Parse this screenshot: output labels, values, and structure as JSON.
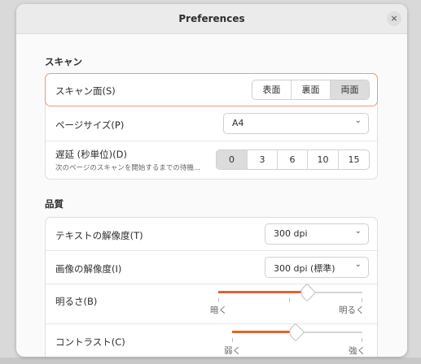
{
  "window": {
    "title": "Preferences",
    "close_glyph": "×"
  },
  "scan_section": {
    "title": "スキャン",
    "scan_side": {
      "label": "スキャン面(S)",
      "options": [
        "表面",
        "裏面",
        "両面"
      ],
      "selected": "両面"
    },
    "page_size": {
      "label": "ページサイズ(P)",
      "value": "A4"
    },
    "delay": {
      "label": "遅延 (秒単位)(D)",
      "sublabel": "次のページのスキャンを開始するまでの待機...",
      "options": [
        "0",
        "3",
        "6",
        "10",
        "15"
      ],
      "selected": "0"
    }
  },
  "quality_section": {
    "title": "品質",
    "text_resolution": {
      "label": "テキストの解像度(T)",
      "value": "300 dpi"
    },
    "image_resolution": {
      "label": "画像の解像度(I)",
      "value": "300 dpi (標準)"
    },
    "brightness": {
      "label": "明るさ(B)",
      "min_label": "暗く",
      "max_label": "明るく",
      "level": 0.6
    },
    "contrast": {
      "label": "コントラスト(C)",
      "min_label": "弱く",
      "max_label": "強く",
      "level": 0.5
    }
  },
  "colors": {
    "accent": "#e0662c",
    "focus_border": "#ef9a7a"
  },
  "icons": {
    "dropdown": "chevron-down-icon",
    "close": "close-icon"
  }
}
